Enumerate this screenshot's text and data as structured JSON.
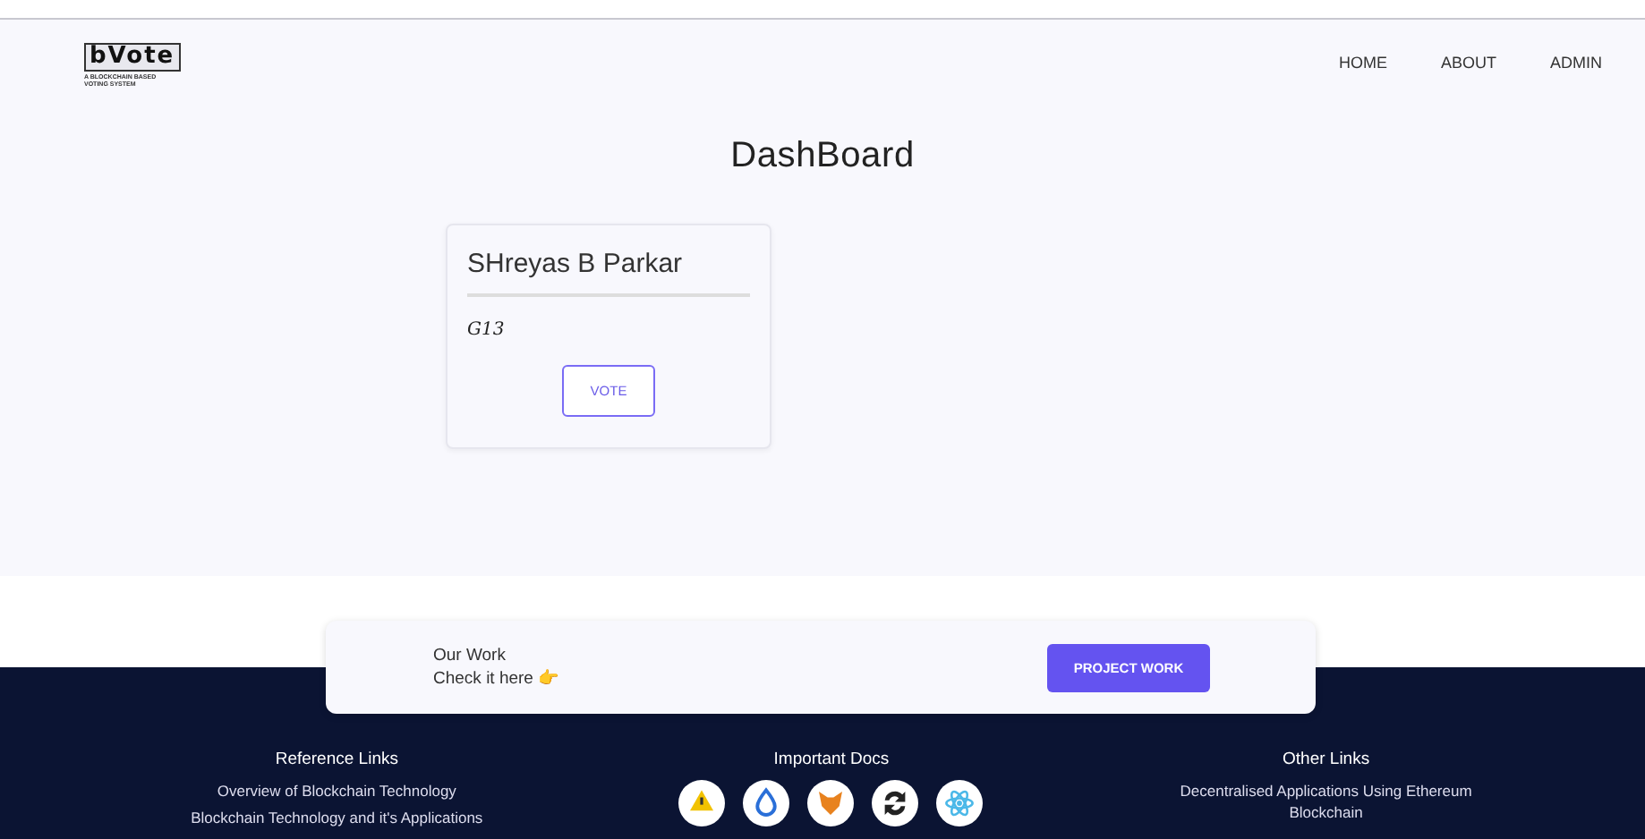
{
  "logo": {
    "title": "bVote",
    "tagline": "A BLOCKCHAIN BASED VOTING SYSTEM"
  },
  "nav": [
    {
      "label": "HOME"
    },
    {
      "label": "ABOUT"
    },
    {
      "label": "ADMIN"
    }
  ],
  "heading": "DashBoard",
  "candidates": [
    {
      "name": "SHreyas B Parkar",
      "code": "G13",
      "button": "VOTE"
    }
  ],
  "promo": {
    "line_1": "Our Work",
    "line_2": "Check it here 👉",
    "button": "PROJECT WORK"
  },
  "footer": {
    "columns": [
      {
        "title": "Reference Links",
        "links": [
          "Overview of Blockchain Technology",
          "Blockchain Technology and it's Applications"
        ]
      },
      {
        "title": "Important Docs",
        "icons": [
          {
            "kind": "warning"
          },
          {
            "kind": "drop"
          },
          {
            "kind": "fox"
          },
          {
            "kind": "sync"
          },
          {
            "kind": "atom"
          }
        ]
      },
      {
        "title": "Other Links",
        "links": [
          "Decentralised Applications Using Ethereum Blockchain"
        ]
      }
    ]
  }
}
